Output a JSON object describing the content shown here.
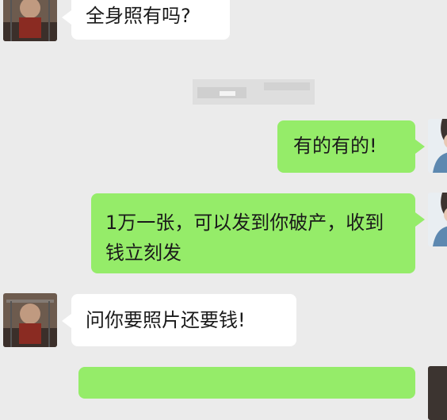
{
  "chat": {
    "messages": [
      {
        "side": "left",
        "text": "全身照有吗?"
      },
      {
        "side": "right",
        "text": "有的有的!"
      },
      {
        "side": "right",
        "text": "1万一张，可以发到你破产，收到钱立刻发"
      },
      {
        "side": "left",
        "text": "问你要照片还要钱!"
      },
      {
        "side": "right",
        "text": ""
      }
    ]
  },
  "colors": {
    "background": "#ebebeb",
    "incoming_bubble": "#ffffff",
    "outgoing_bubble": "#95ec69"
  }
}
